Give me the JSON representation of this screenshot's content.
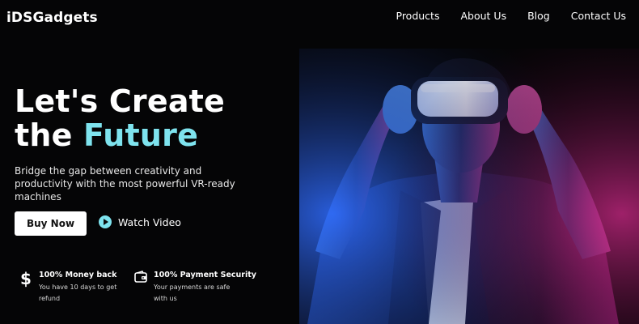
{
  "header": {
    "brand": "iDSGadgets",
    "nav": [
      "Products",
      "About Us",
      "Blog",
      "Contact Us"
    ]
  },
  "hero": {
    "title_line1": "Let's Create",
    "title_line2_prefix": "the ",
    "title_line2_accent": "Future",
    "subtitle": "Bridge the gap between creativity and productivity with the most powerful VR-ready machines",
    "buy_label": "Buy Now",
    "watch_label": "Watch Video"
  },
  "features": [
    {
      "icon": "dollar-icon",
      "title": "100% Money back",
      "desc": "You have 10 days to get refund"
    },
    {
      "icon": "wallet-icon",
      "title": "100% Payment Security",
      "desc": "Your payments are safe with us"
    }
  ],
  "colors": {
    "background": "#050506",
    "accent": "#7ee3ee",
    "button_bg": "#ffffff"
  }
}
